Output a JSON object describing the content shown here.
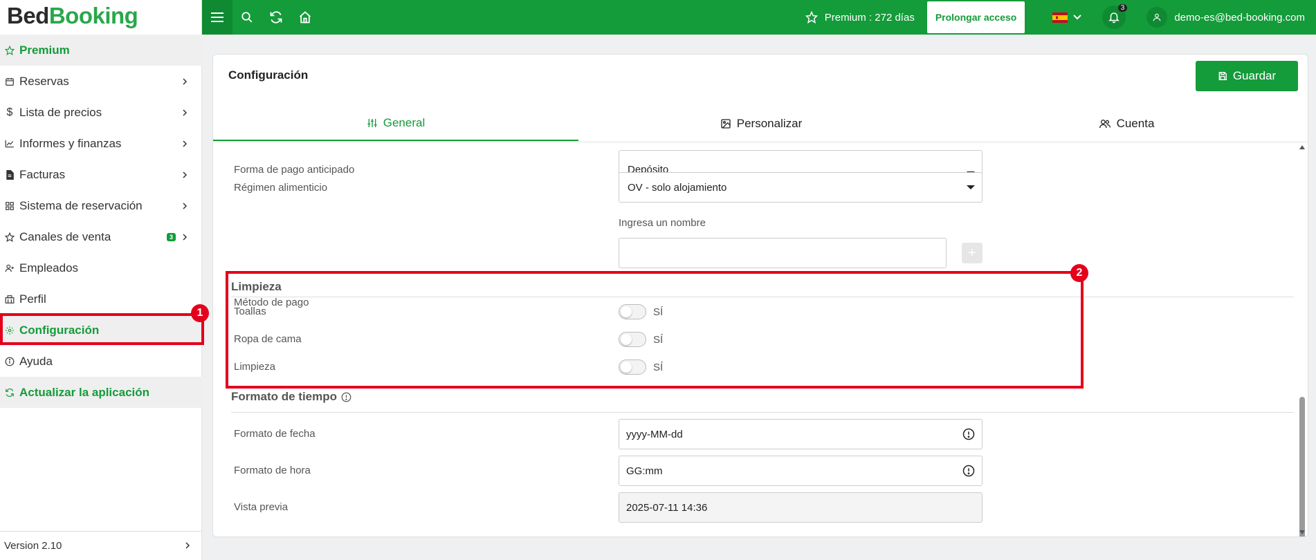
{
  "app": {
    "logo_part1": "Bed",
    "logo_part2": "Booking"
  },
  "sidebar": {
    "items": [
      {
        "label": "Premium",
        "icon": "star-icon",
        "chevron": false
      },
      {
        "label": "Reservas",
        "icon": "calendar-icon",
        "chevron": true
      },
      {
        "label": "Lista de precios",
        "icon": "dollar-icon",
        "chevron": true
      },
      {
        "label": "Informes y finanzas",
        "icon": "chart-line-icon",
        "chevron": true
      },
      {
        "label": "Facturas",
        "icon": "invoice-icon",
        "chevron": true
      },
      {
        "label": "Sistema de reservación",
        "icon": "grid-icon",
        "chevron": true
      },
      {
        "label": "Canales de venta",
        "icon": "star-icon",
        "chevron": true,
        "badge": "3"
      },
      {
        "label": "Empleados",
        "icon": "user-plus-icon",
        "chevron": false
      },
      {
        "label": "Perfil",
        "icon": "building-icon",
        "chevron": false
      },
      {
        "label": "Configuración",
        "icon": "gear-icon",
        "chevron": false
      },
      {
        "label": "Ayuda",
        "icon": "info-icon",
        "chevron": false
      },
      {
        "label": "Actualizar la aplicación",
        "icon": "refresh-icon",
        "chevron": false
      }
    ],
    "version": "Version 2.10"
  },
  "topbar": {
    "premium_text": "Premium : 272 días",
    "prolong_label": "Prolongar acceso",
    "notifications_count": "3",
    "user_email": "demo-es@bed-booking.com",
    "language": "es"
  },
  "page": {
    "title": "Configuración",
    "save_label": "Guardar",
    "tabs": [
      {
        "label": "General",
        "icon": "sliders-icon",
        "active": true
      },
      {
        "label": "Personalizar",
        "icon": "image-icon",
        "active": false
      },
      {
        "label": "Cuenta",
        "icon": "users-icon",
        "active": false
      }
    ]
  },
  "form": {
    "prepayment_label": "Forma de pago anticipado",
    "prepayment_value": "Depósito",
    "meal_label": "Régimen alimenticio",
    "meal_value": "OV - solo alojamiento",
    "payment_method_label": "Método de pago",
    "payment_method_hint": "Ingresa un nombre",
    "payment_method_value": "",
    "cleaning_section": "Limpieza",
    "cleaning_items": [
      {
        "label": "Toallas",
        "toggle_text": "SÍ",
        "on": false
      },
      {
        "label": "Ropa de cama",
        "toggle_text": "SÍ",
        "on": false
      },
      {
        "label": "Limpieza",
        "toggle_text": "SÍ",
        "on": false
      }
    ],
    "time_section": "Formato de tiempo",
    "date_format_label": "Formato de fecha",
    "date_format_value": "yyyy-MM-dd",
    "time_format_label": "Formato de hora",
    "time_format_value": "GG:mm",
    "preview_label": "Vista previa",
    "preview_value": "2025-07-11 14:36"
  },
  "annotations": {
    "marker1": "1",
    "marker2": "2"
  },
  "colors": {
    "brand_green": "#149b3a",
    "highlight_red": "#e4001b"
  }
}
